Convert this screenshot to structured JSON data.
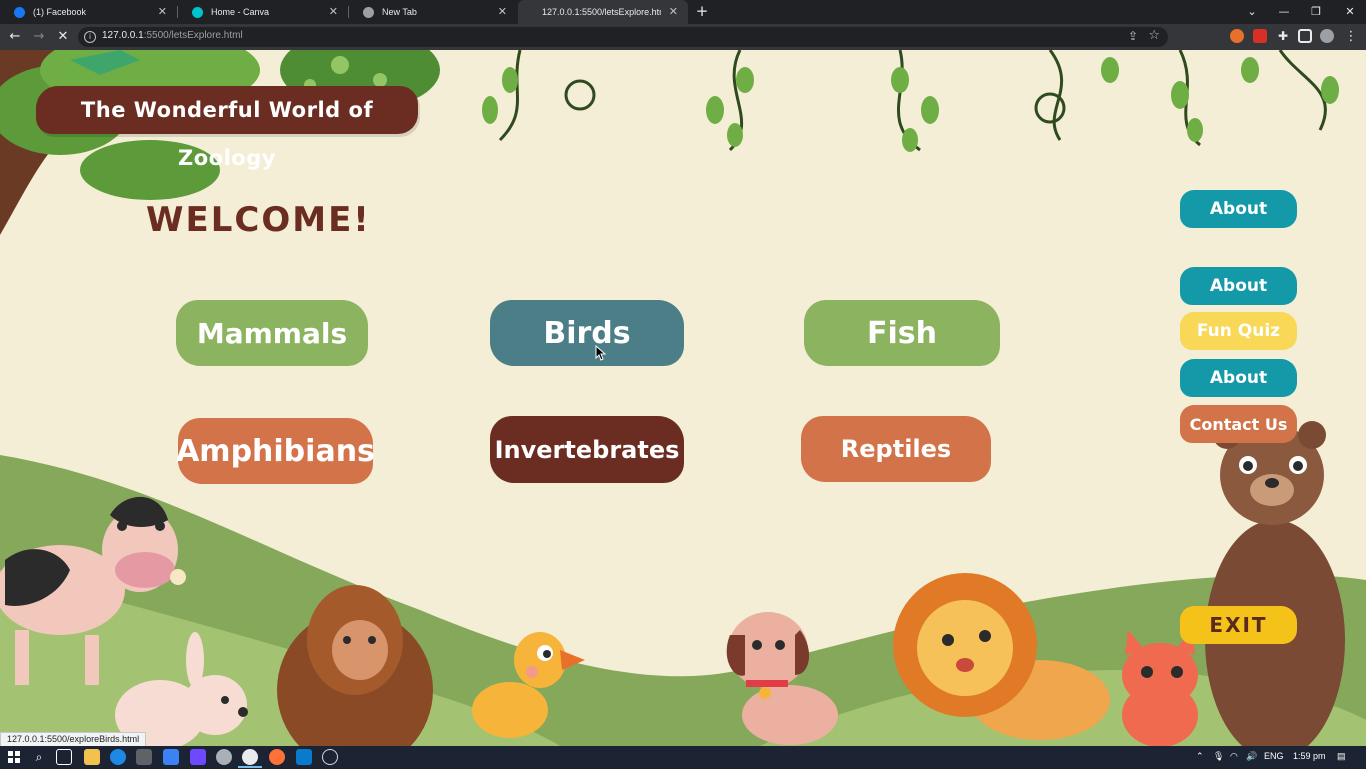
{
  "browser": {
    "tabs": [
      {
        "label": "(1) Facebook",
        "favicon_color": "#1877f2",
        "active": false
      },
      {
        "label": "Home - Canva",
        "favicon_color": "#00c4cc",
        "active": false
      },
      {
        "label": "New Tab",
        "favicon_color": "#9aa0a6",
        "active": false
      },
      {
        "label": "127.0.0.1:5500/letsExplore.html",
        "favicon_color": "#35363a",
        "active": true
      }
    ],
    "new_tab_glyph": "+",
    "url_host": "127.0.0.1",
    "url_rest": ":5500/letsExplore.html",
    "status_url": "127.0.0.1:5500/exploreBirds.html",
    "icons": [
      "back-icon",
      "forward-icon",
      "stop-icon",
      "info-icon",
      "share-icon",
      "star-icon",
      "extension-icon",
      "menu-icon"
    ]
  },
  "site": {
    "title": "The Wonderful World of Zoology",
    "welcome": "WELCOME!",
    "categories": [
      {
        "label": "Mammals",
        "color": "#8cb35f"
      },
      {
        "label": "Birds",
        "color": "#4b7e87"
      },
      {
        "label": "Fish",
        "color": "#8cb35f"
      },
      {
        "label": "Amphibians",
        "color": "#d2734a"
      },
      {
        "label": "Invertebrates",
        "color": "#6b2d22"
      },
      {
        "label": "Reptiles",
        "color": "#d2734a"
      }
    ],
    "side_nav": [
      {
        "label": "About",
        "color": "#1499a8",
        "text_color": "#ffffff"
      },
      {
        "label": "About",
        "color": "#1499a8",
        "text_color": "#ffffff"
      },
      {
        "label": "Fun Quiz",
        "color": "#f8d856",
        "text_color": "#ffffff"
      },
      {
        "label": "About",
        "color": "#1499a8",
        "text_color": "#ffffff"
      },
      {
        "label": "Contact Us",
        "color": "#d2734a",
        "text_color": "#ffffff"
      }
    ],
    "exit": {
      "label": "EXIT",
      "color": "#f5c21a",
      "text_color": "#5a2a1c"
    },
    "colors": {
      "background": "#f4eed6",
      "hill_dark": "#86a85a",
      "hill_light": "#a3c373",
      "brown": "#6b2d22"
    }
  },
  "taskbar": {
    "tray_lang": "ENG",
    "clock": "1:59 pm"
  }
}
